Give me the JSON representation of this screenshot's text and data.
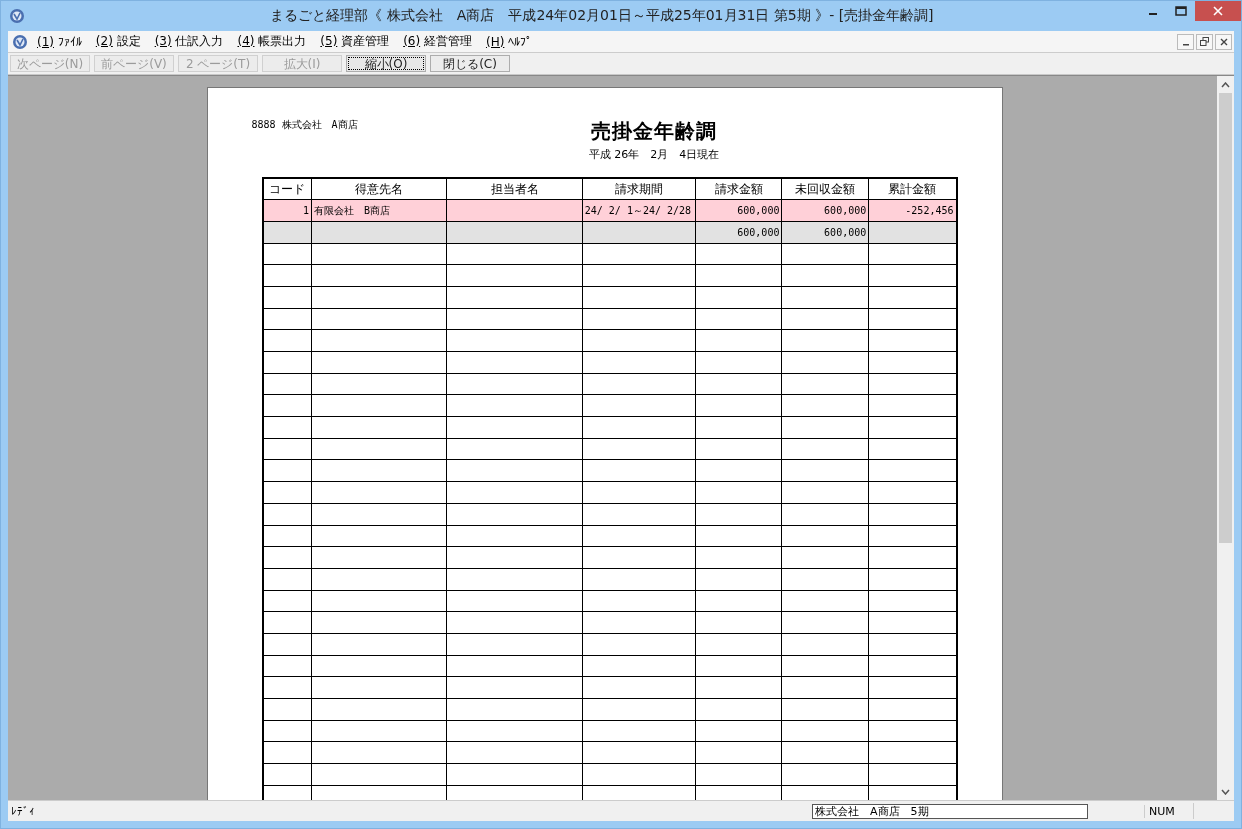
{
  "window": {
    "title": "まるごと経理部《 株式会社　A商店　平成24年02月01日～平成25年01月31日 第5期 》- [売掛金年齢調]"
  },
  "menu": [
    {
      "accel": "(1)",
      "label": "ﾌｧｲﾙ"
    },
    {
      "accel": "(2)",
      "label": "設定"
    },
    {
      "accel": "(3)",
      "label": "仕訳入力"
    },
    {
      "accel": "(4)",
      "label": "帳票出力"
    },
    {
      "accel": "(5)",
      "label": "資産管理"
    },
    {
      "accel": "(6)",
      "label": "経営管理"
    },
    {
      "accel": "(H)",
      "label": "ﾍﾙﾌﾟ"
    }
  ],
  "toolbar": [
    {
      "label": "次ページ(N)",
      "disabled": true,
      "focused": false
    },
    {
      "label": "前ページ(V)",
      "disabled": true,
      "focused": false
    },
    {
      "label": "2 ページ(T)",
      "disabled": true,
      "focused": false
    },
    {
      "label": "拡大(I)",
      "disabled": true,
      "focused": false
    },
    {
      "label": "縮小(O)",
      "disabled": false,
      "focused": true
    },
    {
      "label": "閉じる(C)",
      "disabled": false,
      "focused": false
    }
  ],
  "report": {
    "company": "8888  株式会社　A商店",
    "title": "売掛金年齢調",
    "date": "平成 26年　2月　4日現在",
    "table": {
      "columns": [
        "コード",
        "得意先名",
        "担当者名",
        "請求期間",
        "請求金額",
        "未回収金額",
        "累計金額"
      ],
      "rows": [
        {
          "kind": "detail",
          "cells": [
            "1",
            "有限会社　B商店",
            "",
            "24/ 2/ 1～24/ 2/28",
            "600,000",
            "600,000",
            "-252,456"
          ]
        },
        {
          "kind": "total",
          "cells": [
            "",
            "",
            "",
            "",
            "600,000",
            "600,000",
            ""
          ]
        }
      ]
    }
  },
  "status_bar": {
    "state": "ﾚﾃﾞｨ",
    "company": "株式会社　A商店　5期",
    "num": "NUM"
  }
}
